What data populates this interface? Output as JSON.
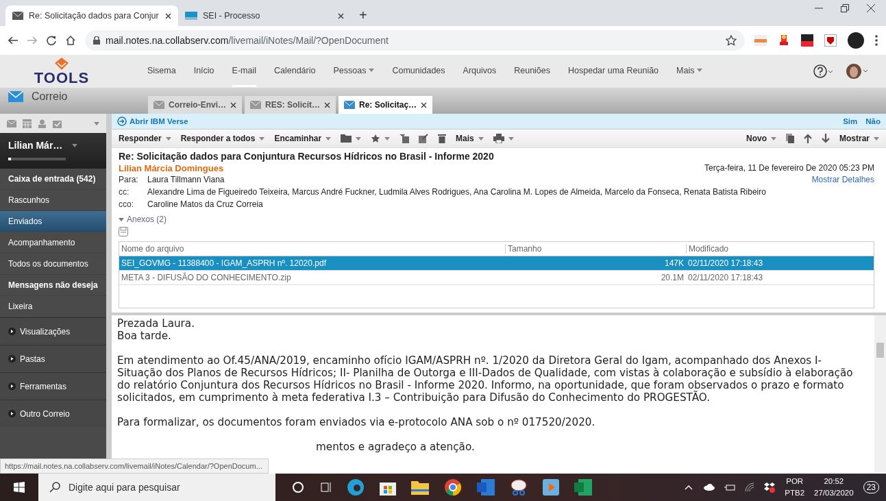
{
  "browser": {
    "tabs": [
      {
        "title": "Re: Solicitação dados para Conjur",
        "selected": true
      },
      {
        "title": "SEI - Processo",
        "selected": false
      }
    ],
    "new_tab": "+",
    "url_host": "mail.notes.na.collabserv.com",
    "url_path": "/livemail/iNotes/Mail/?OpenDocument"
  },
  "app_header": {
    "logo": "TOOLS",
    "nav": [
      {
        "label": "Sisema",
        "selected": false,
        "menu": false
      },
      {
        "label": "Início",
        "selected": false,
        "menu": false
      },
      {
        "label": "E-mail",
        "selected": true,
        "menu": false
      },
      {
        "label": "Calendário",
        "selected": false,
        "menu": false
      },
      {
        "label": "Pessoas",
        "selected": false,
        "menu": true
      },
      {
        "label": "Comunidades",
        "selected": false,
        "menu": false
      },
      {
        "label": "Arquivos",
        "selected": false,
        "menu": false
      },
      {
        "label": "Reuniões",
        "selected": false,
        "menu": false
      },
      {
        "label": "Hospedar uma Reunião",
        "selected": false,
        "menu": false
      },
      {
        "label": "Mais",
        "selected": false,
        "menu": true
      }
    ]
  },
  "section_title": "Correio",
  "doc_tabs": [
    {
      "label": "Correio-Envi…",
      "selected": false
    },
    {
      "label": "RES: Solicit…",
      "selected": false
    },
    {
      "label": "Re: Solicitaç…",
      "selected": true
    }
  ],
  "sidebar": {
    "user": "Lilian Már…",
    "folders": [
      {
        "label": "Caixa de entrada (542)",
        "bold": true,
        "selected": false
      },
      {
        "label": "Rascunhos",
        "bold": false,
        "selected": false
      },
      {
        "label": "Enviados",
        "bold": false,
        "selected": true
      },
      {
        "label": "Acompanhamento",
        "bold": false,
        "selected": false
      },
      {
        "label": "Todos os documentos",
        "bold": false,
        "selected": false
      },
      {
        "label": "Mensagens não deseja",
        "bold": true,
        "selected": false
      },
      {
        "label": "Lixeira",
        "bold": false,
        "selected": false
      }
    ],
    "sections": [
      {
        "label": "Visualizações",
        "expanded": false
      },
      {
        "label": "Pastas",
        "expanded": false
      },
      {
        "label": "Ferramentas",
        "expanded": false
      },
      {
        "label": "Outro Correio",
        "expanded": false
      }
    ]
  },
  "banner": {
    "link": "Abrir IBM Verse",
    "buttons": [
      "Sim",
      "Não"
    ]
  },
  "toolbar": {
    "actions": [
      "Responder",
      "Responder a todos",
      "Encaminhar"
    ],
    "more": "Mais",
    "new": "Novo",
    "show": "Mostrar"
  },
  "message": {
    "subject": "Re: Solicitação dados para Conjuntura Recursos Hídricos no Brasil - Informe 2020",
    "sender": "Lilian Márcia Domingues",
    "date": "Terça-feira, 11 De fevereiro De 2020 05:23 PM",
    "details_link": "Mostrar Detalhes",
    "recipients": [
      {
        "label": "Para:",
        "value": "Laura Tillmann Viana"
      },
      {
        "label": "cc:",
        "value": "Alexandre Lima de Figueiredo Teixeira, Marcus André Fuckner, Ludmila Alves Rodrigues, Ana Carolina M. Lopes de Almeida, Marcelo da Fonseca, Renata Batista Ribeiro"
      },
      {
        "label": "cco:",
        "value": "Caroline Matos da Cruz Correia"
      }
    ],
    "attachments": {
      "toggle": "Anexos (2)",
      "expanded": true,
      "columns": [
        "Nome do arquivo",
        "Tamanho",
        "Modificado"
      ],
      "rows": [
        {
          "name": "SEI_GOVMG - 11388400 - IGAM_ASPRH nº. 12020.pdf",
          "size": "147K",
          "modified": "02/11/2020 17:18:43",
          "selected": true
        },
        {
          "name": "META 3 - DIFUSÃO DO CONHECIMENTO.zip",
          "size": "20.1M",
          "modified": "02/11/2020 17:18:43",
          "selected": false
        }
      ]
    },
    "body": [
      "Prezada Laura.",
      "Boa tarde.",
      "Em atendimento ao Of.45/ANA/2019, encaminho ofício IGAM/ASPRH nº. 1/2020 da Diretora Geral do Igam, acompanhado dos Anexos I- Situação dos Planos de Recursos Hídricos; II- Planilha de Outorga e III-Dados de Qualidade, com vistas à colaboração e subsídio à elaboração do relatório Conjuntura dos Recursos Hídricos no Brasil - Informe 2020. Informo, na oportunidade, que foram observados o prazo e formato solicitados, em cumprimento à meta federativa I.3 – Contribuição para Difusão do Conhecimento do PROGESTÃO.",
      "Para formalizar, os documentos foram enviados via e-protocolo ANA sob o nº 017520/2020."
    ],
    "body_partial": "mentos e agradeço a atenção."
  },
  "status_url": "https://mail.notes.na.collabserv.com/livemail/iNotes/Calendar/?OpenDocum...",
  "taskbar": {
    "search_placeholder": "Digite aqui para pesquisar",
    "lang": "POR",
    "layout": "PTB2",
    "time": "20:52",
    "date": "27/03/2020",
    "notifications": "23"
  }
}
